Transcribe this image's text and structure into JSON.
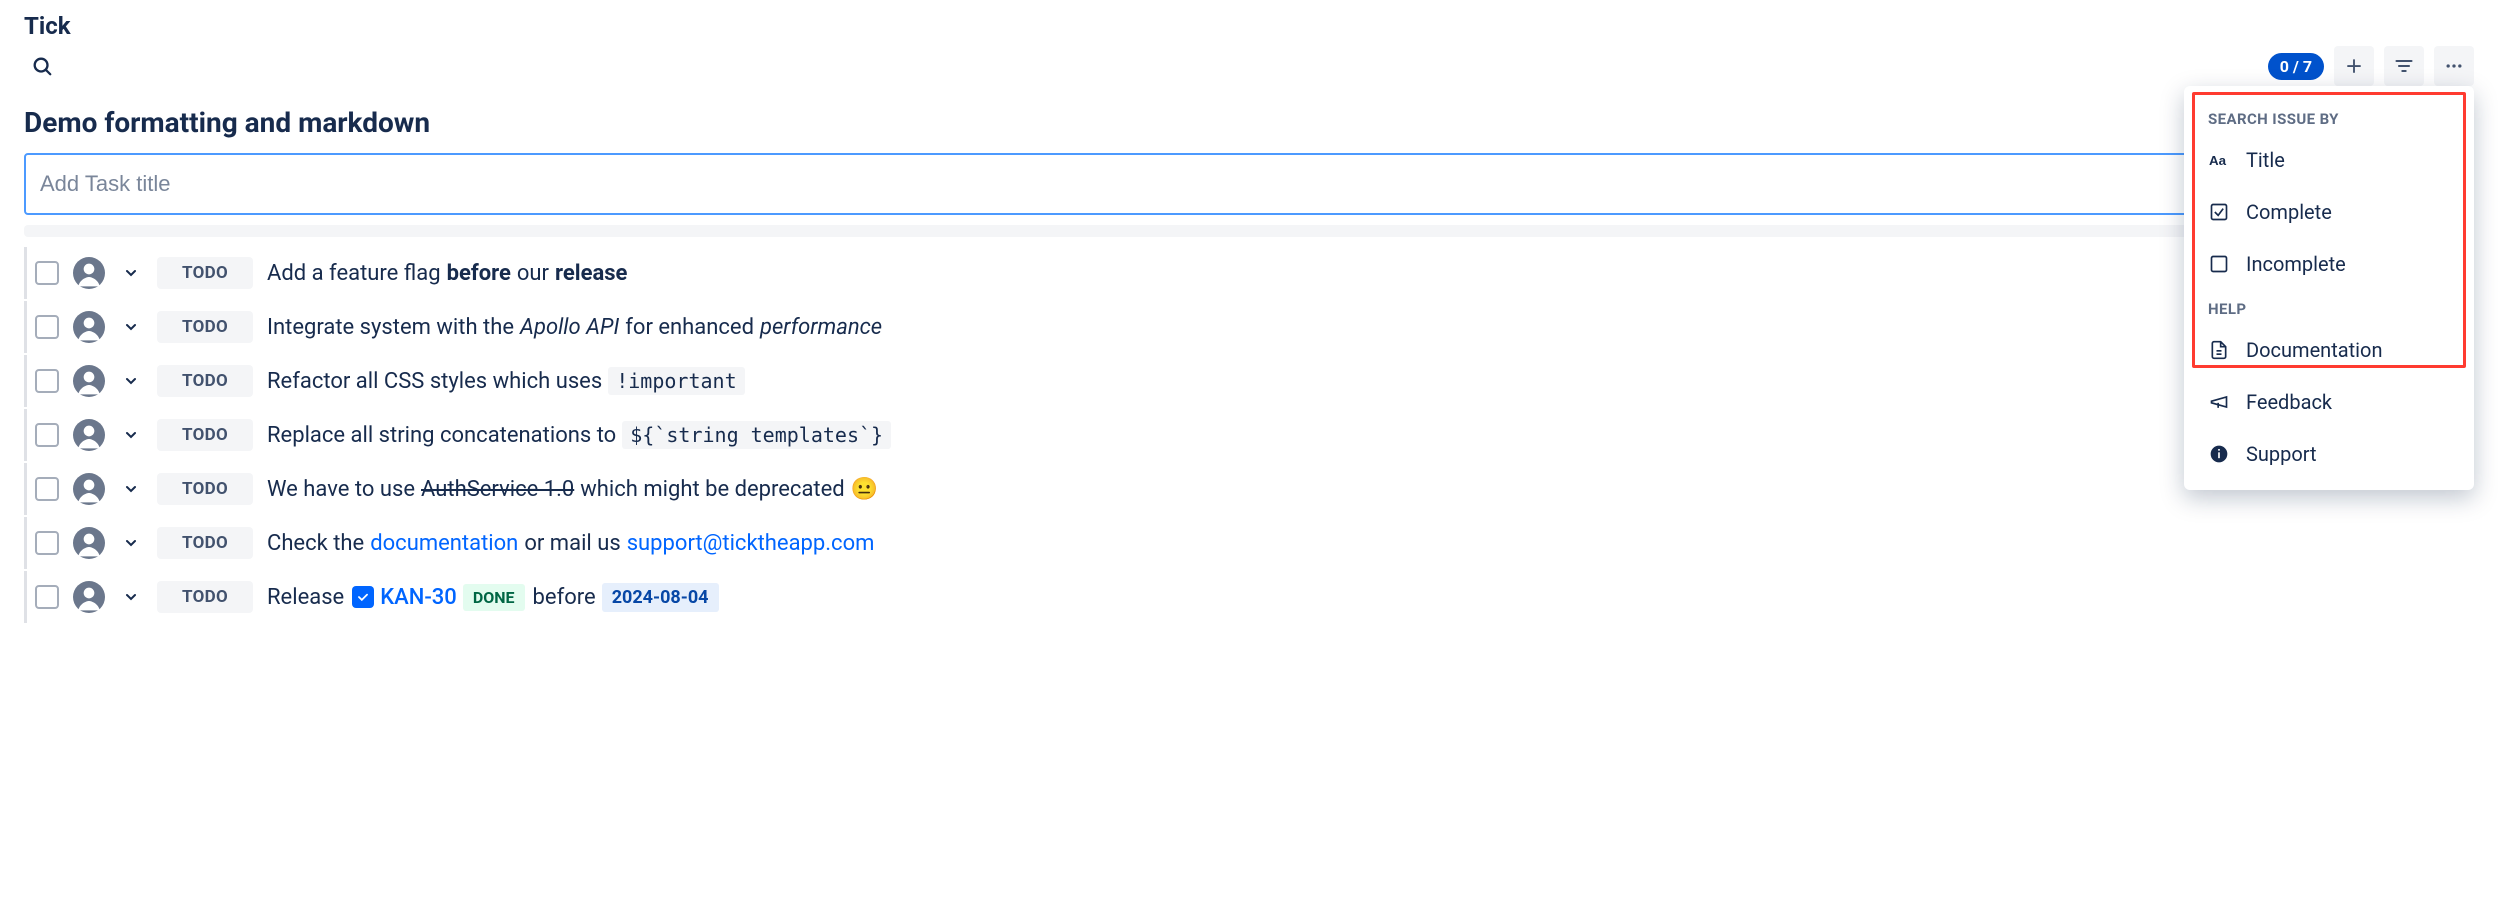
{
  "app_title": "Tick",
  "badge": "0 / 7",
  "page_title": "Demo formatting and markdown",
  "add_placeholder": "Add Task title",
  "status_label": "TODO",
  "tasks": [
    {
      "parts": [
        {
          "t": "Add a feature flag "
        },
        {
          "t": "before",
          "b": true
        },
        {
          "t": " our "
        },
        {
          "t": "release",
          "b": true
        }
      ]
    },
    {
      "parts": [
        {
          "t": "Integrate system with the "
        },
        {
          "t": "Apollo API",
          "i": true
        },
        {
          "t": " for enhanced "
        },
        {
          "t": "performance",
          "i": true
        }
      ]
    },
    {
      "parts": [
        {
          "t": "Refactor all CSS styles which uses "
        },
        {
          "t": "!important",
          "code": true
        }
      ]
    },
    {
      "parts": [
        {
          "t": "Replace all string concatenations to "
        },
        {
          "t": "${`string templates`}",
          "code": true
        }
      ]
    },
    {
      "parts": [
        {
          "t": "We have to use "
        },
        {
          "t": "AuthService 1.0",
          "strike": true
        },
        {
          "t": " which might be deprecated "
        },
        {
          "t": "😐",
          "emoji": true
        }
      ]
    },
    {
      "parts": [
        {
          "t": "Check the "
        },
        {
          "t": "documentation",
          "link": true
        },
        {
          "t": " or mail us "
        },
        {
          "t": "support@ticktheapp.com",
          "link": true
        }
      ]
    },
    {
      "parts": [
        {
          "t": "Release "
        },
        {
          "issue": {
            "key": "KAN-30",
            "status": "DONE"
          }
        },
        {
          "t": " before "
        },
        {
          "date": "2024-08-04"
        }
      ]
    }
  ],
  "dropdown": {
    "search_header": "SEARCH ISSUE BY",
    "search_items": [
      "Title",
      "Complete",
      "Incomplete"
    ],
    "help_header": "HELP",
    "help_items": [
      "Documentation",
      "Feedback",
      "Support"
    ]
  }
}
